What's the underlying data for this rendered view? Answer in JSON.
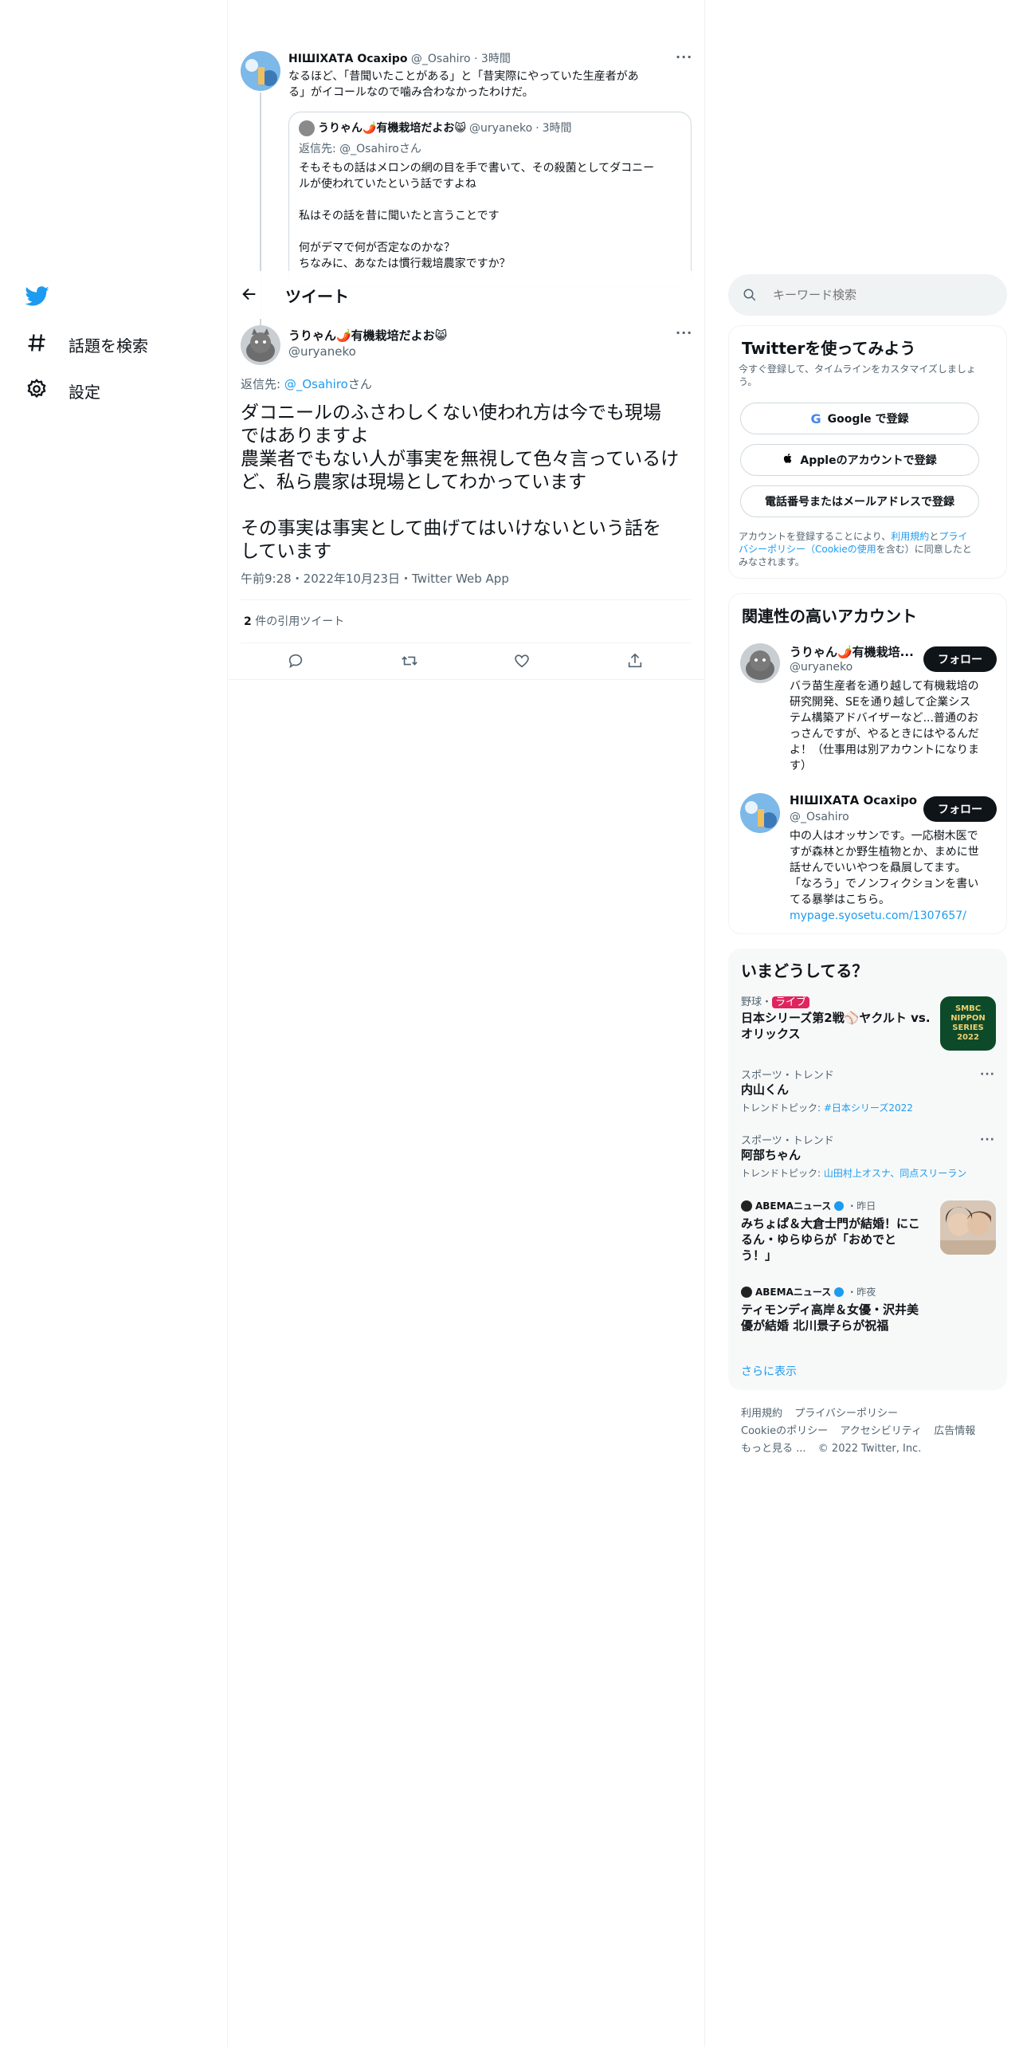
{
  "nav": {
    "items": [
      {
        "label": "話題を検索",
        "icon": "hashtag-icon"
      },
      {
        "label": "設定",
        "icon": "gear-icon"
      }
    ]
  },
  "header": {
    "title": "ツイート"
  },
  "parent_tweet": {
    "name": "НІШІХАТА Осахіро",
    "handle": "@_Osahiro",
    "time": "3時間",
    "text1": "なるほど、「昔聞いたことがある」と「昔実際にやっていた生産者があ",
    "text2": "る」がイコールなので噛み合わなかったわけだ。"
  },
  "quoted_tweet": {
    "name": "うりゃん🌶️有機栽培だよお😸",
    "handle": "@uryaneko",
    "time": "3時間",
    "reply_to": "返信先: @_Osahiroさん",
    "line1": "そもそもの話はメロンの網の目を手で書いて、その殺菌としてダコニー",
    "line2": "ルが使われていたという話ですよね",
    "line3": "私はその話を昔に聞いたと言うことです",
    "line4": "何がデマで何が否定なのかな？",
    "line5": "ちなみに、あなたは慣行栽培農家ですか？"
  },
  "main_tweet": {
    "name": "うりゃん🌶️有機栽培だよお😸",
    "handle": "@uryaneko",
    "reply_prefix": "返信先: ",
    "reply_handle": "@_Osahiro",
    "reply_suffix": "さん",
    "p1a": "ダコニールのふさわしくない使われ方は今でも現場",
    "p1b": "ではありますよ",
    "p1c": "農業者でもない人が事実を無視して色々言っているけ",
    "p1d": "ど、私ら農家は現場としてわかっています",
    "p2a": "その事実は事実として曲げてはいけないという話を",
    "p2b": "しています",
    "meta": "午前9:28・2022年10月23日・Twitter Web App",
    "quote_count": "2",
    "quote_label": " 件の引用ツイート"
  },
  "search": {
    "placeholder": "キーワード検索"
  },
  "signup": {
    "title": "Twitterを使ってみよう",
    "subtitle1": "今すぐ登録して、タイムラインをカスタマイズしましょ",
    "subtitle2": "う。",
    "google": "Google で登録",
    "apple": "Appleのアカウントで登録",
    "phone": "電話番号またはメールアドレスで登録",
    "terms_a": "アカウントを登録することにより、",
    "terms_b": "利用規約",
    "terms_c": "と",
    "terms_d": "プライ",
    "terms_e": "バシーポリシー（Cookieの使用",
    "terms_f": "を含む）に同意したと",
    "terms_g": "みなされます。"
  },
  "related": {
    "title": "関連性の高いアカウント",
    "accounts": [
      {
        "name": "うりゃん🌶️有機栽培...",
        "handle": "@uryaneko",
        "follow": "フォロー",
        "bio": [
          "バラ苗生産者を通り越して有機栽培の",
          "研究開発、SEを通り越して企業シス",
          "テム構築アドバイザーなど...普通のお",
          "っさんですが、やるときにはやるんだ",
          "よ！（仕事用は別アカウントになりま",
          "す）"
        ]
      },
      {
        "name": "НІШІХАТА Осахіро",
        "handle": "@_Osahiro",
        "follow": "フォロー",
        "bio": [
          "中の人はオッサンです。一応樹木医で",
          "すが森林とか野生植物とか、まめに世",
          "話せんでいいやつを贔屓してます。",
          "「なろう」でノンフィクションを書い",
          "てる暴挙はこちら。"
        ],
        "link": "mypage.syosetu.com/1307657/"
      }
    ]
  },
  "trends": {
    "title": "いまどうしてる？",
    "items": [
      {
        "meta": "野球・",
        "badge": "ライブ",
        "title1": "日本シリーズ第2戦⚾ヤクルト vs.",
        "title2": "オリックス"
      },
      {
        "meta": "スポーツ・トレンド",
        "title": "内山くん",
        "topic_label": "トレンドトピック: ",
        "topic": "#日本シリーズ2022"
      },
      {
        "meta": "スポーツ・トレンド",
        "title": "阿部ちゃん",
        "topic_label": "トレンドトピック: ",
        "topic": "山田村上オスナ、同点スリーラン"
      },
      {
        "source": "ABEMAニュース",
        "time": "・昨日",
        "title": [
          "みちょぱ＆大倉士門が結婚！にこ",
          "るん・ゆらゆらが「おめでと",
          "う！」"
        ]
      },
      {
        "source": "ABEMAニュース",
        "time": "・昨夜",
        "title": [
          "ティモンディ高岸＆女優・沢井美",
          "優が結婚 北川景子らが祝福"
        ]
      }
    ],
    "show_more": "さらに表示",
    "thumb1_text": "SMBC NIPPON SERIES 2022"
  },
  "footer": {
    "row1": [
      "利用規約",
      "プライバシーポリシー"
    ],
    "row2": [
      "Cookieのポリシー",
      "アクセシビリティ",
      "広告情報"
    ],
    "row3": [
      "もっと見る ...",
      "© 2022 Twitter, Inc."
    ]
  },
  "colors": {
    "accent": "#1d9bf0",
    "text": "#0f1419",
    "muted": "#536471",
    "live": "#e0245e"
  }
}
